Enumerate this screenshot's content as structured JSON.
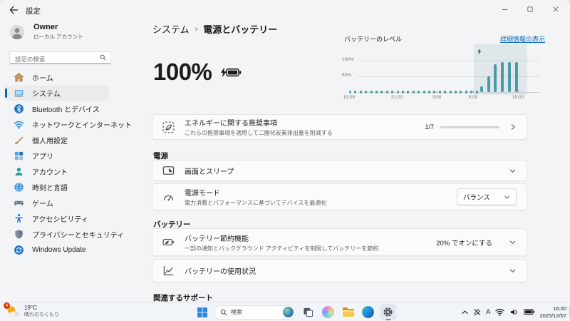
{
  "window": {
    "title": "設定"
  },
  "sidebar": {
    "user_name": "Owner",
    "user_type": "ローカル アカウント",
    "search_placeholder": "設定の検索",
    "items": [
      {
        "label": "ホーム",
        "icon": "home",
        "selected": false
      },
      {
        "label": "システム",
        "icon": "system",
        "selected": true
      },
      {
        "label": "Bluetooth とデバイス",
        "icon": "bluetooth",
        "selected": false
      },
      {
        "label": "ネットワークとインターネット",
        "icon": "network",
        "selected": false
      },
      {
        "label": "個人用設定",
        "icon": "personalization",
        "selected": false
      },
      {
        "label": "アプリ",
        "icon": "apps",
        "selected": false
      },
      {
        "label": "アカウント",
        "icon": "accounts",
        "selected": false
      },
      {
        "label": "時刻と言語",
        "icon": "time-language",
        "selected": false
      },
      {
        "label": "ゲーム",
        "icon": "gaming",
        "selected": false
      },
      {
        "label": "アクセシビリティ",
        "icon": "accessibility",
        "selected": false
      },
      {
        "label": "プライバシーとセキュリティ",
        "icon": "privacy",
        "selected": false
      },
      {
        "label": "Windows Update",
        "icon": "windows-update",
        "selected": false
      }
    ]
  },
  "header": {
    "breadcrumb_root": "システム",
    "breadcrumb_sep": "›",
    "breadcrumb_current": "電源とバッテリー"
  },
  "battery_hero": {
    "percent": "100%"
  },
  "chart_data": {
    "type": "bar",
    "title": "バッテリーのレベル",
    "detail_link": "詳細情報の表示",
    "y_ticks": [
      "100%",
      "50%"
    ],
    "x_ticks": [
      "15:00",
      "21:00",
      "3:00",
      "9:00",
      "15:00"
    ],
    "ylim": [
      0,
      100
    ],
    "values": [
      2,
      2,
      2,
      2,
      2,
      2,
      2,
      2,
      2,
      2,
      2,
      2,
      2,
      2,
      2,
      2,
      2,
      2,
      2,
      2,
      2,
      2,
      2,
      2,
      2,
      18,
      50,
      88,
      96,
      96,
      96
    ],
    "charging_start_index": 25,
    "bar_color": "#4a9aa8"
  },
  "energy_card": {
    "title": "エネルギーに関する推奨事項",
    "subtitle": "これらの推奨事項を適用して二酸化炭素排出量を削減する",
    "progress_label": "1/7",
    "progress_fraction": 0.2
  },
  "sections": [
    {
      "label": "電源",
      "cards": [
        {
          "title": "画面とスリープ"
        },
        {
          "title": "電源モード",
          "subtitle": "電力消費とパフォーマンスに基づいてデバイスを最適化",
          "dropdown_value": "バランス"
        }
      ]
    },
    {
      "label": "バッテリー",
      "cards": [
        {
          "title": "バッテリー節約機能",
          "subtitle": "一部の通知とバックグラウンド アクティビティを制限してバッテリーを節約",
          "control_text": "20% でオンにする"
        },
        {
          "title": "バッテリーの使用状況"
        }
      ]
    }
  ],
  "related_support_label": "関連するサポート",
  "taskbar": {
    "weather_temp": "19°C",
    "weather_desc": "晴れのちくもり",
    "weather_badge": "4",
    "search_placeholder": "検索",
    "tray": {
      "ime": "A",
      "time": "16:00",
      "date": "2025/12/07"
    }
  }
}
